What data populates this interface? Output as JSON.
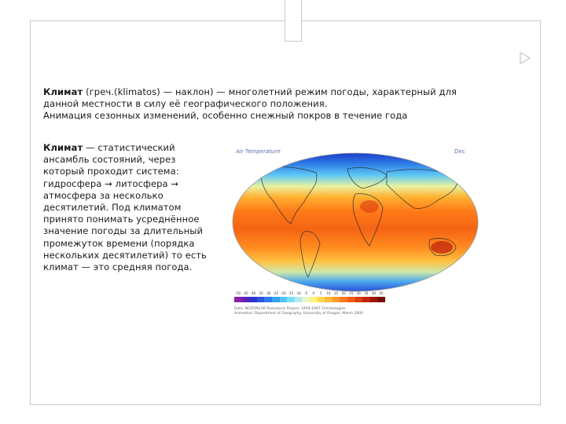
{
  "intro": {
    "term": "Климат",
    "line1": " (греч.(klimatos) — наклон) — многолетний режим погоды, характерный для",
    "line2": "данной местности в силу её географического положения.",
    "line3": "Анимация сезонных изменений, особенно снежный покров в течение года"
  },
  "side": {
    "term": "Климат",
    "text": " — статистический ансамбль состояний, через который проходит система: гидросфера → литосфера → атмосфера за несколько десятилетий. Под климатом принято понимать усреднённое значение погоды за длительный промежуток времени (порядка нескольких десятилетий) то есть климат — это средняя погода."
  },
  "map": {
    "title": "Air Temperature",
    "month": "Dec",
    "ticks": [
      "-50",
      "-45",
      "-40",
      "-35",
      "-30",
      "-25",
      "-20",
      "-15",
      "-10",
      "-5",
      "0",
      "5",
      "10",
      "15",
      "20",
      "25",
      "30",
      "35",
      "40",
      "45"
    ],
    "colorbar_colors": [
      "#8a1fa8",
      "#5a22b8",
      "#3030d0",
      "#2e54e0",
      "#2f7de8",
      "#35a4f0",
      "#4ec6f6",
      "#7ddcf6",
      "#b5ecf2",
      "#e6f5c8",
      "#fff07a",
      "#ffd84a",
      "#ffb838",
      "#ff9a2a",
      "#ff7a1e",
      "#f25a14",
      "#dc3c10",
      "#c0240c",
      "#9c160a",
      "#7a0e08"
    ],
    "credit_line1": "Data: NCEP/NCAR Reanalysis Project, 1959-1997 Climatologies",
    "credit_line2": "Animation: Department of Geography, University of Oregon, March 2000"
  }
}
